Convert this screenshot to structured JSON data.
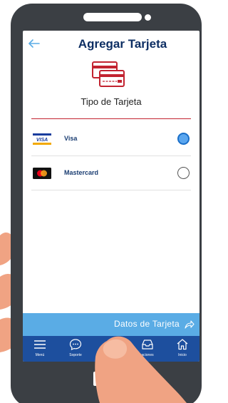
{
  "header": {
    "title": "Agregar Tarjeta",
    "back_icon": "back-arrow-icon"
  },
  "section": {
    "subtitle": "Tipo de Tarjeta",
    "illustration_icon": "credit-card-icon"
  },
  "card_options": [
    {
      "label": "Visa",
      "logo_text": "VISA",
      "logo_icon": "visa-logo",
      "selected": true
    },
    {
      "label": "Mastercard",
      "logo_icon": "mastercard-logo",
      "selected": false
    }
  ],
  "footer": {
    "button_label": "Datos de Tarjeta",
    "button_icon": "share-arrow-icon"
  },
  "nav": {
    "items": [
      {
        "label": "Menú",
        "icon": "menu-icon"
      },
      {
        "label": "Soporte",
        "icon": "chat-icon"
      },
      {
        "label": "",
        "icon": ""
      },
      {
        "label": "aciones",
        "icon": "inbox-icon"
      },
      {
        "label": "Inicio",
        "icon": "home-icon"
      }
    ]
  },
  "colors": {
    "title": "#0d2e63",
    "accent_red": "#c22330",
    "footer_button": "#5aace5",
    "nav_bg": "#1d4f9e",
    "phone_body": "#3b3f44",
    "hand_skin": "#f0a383"
  }
}
